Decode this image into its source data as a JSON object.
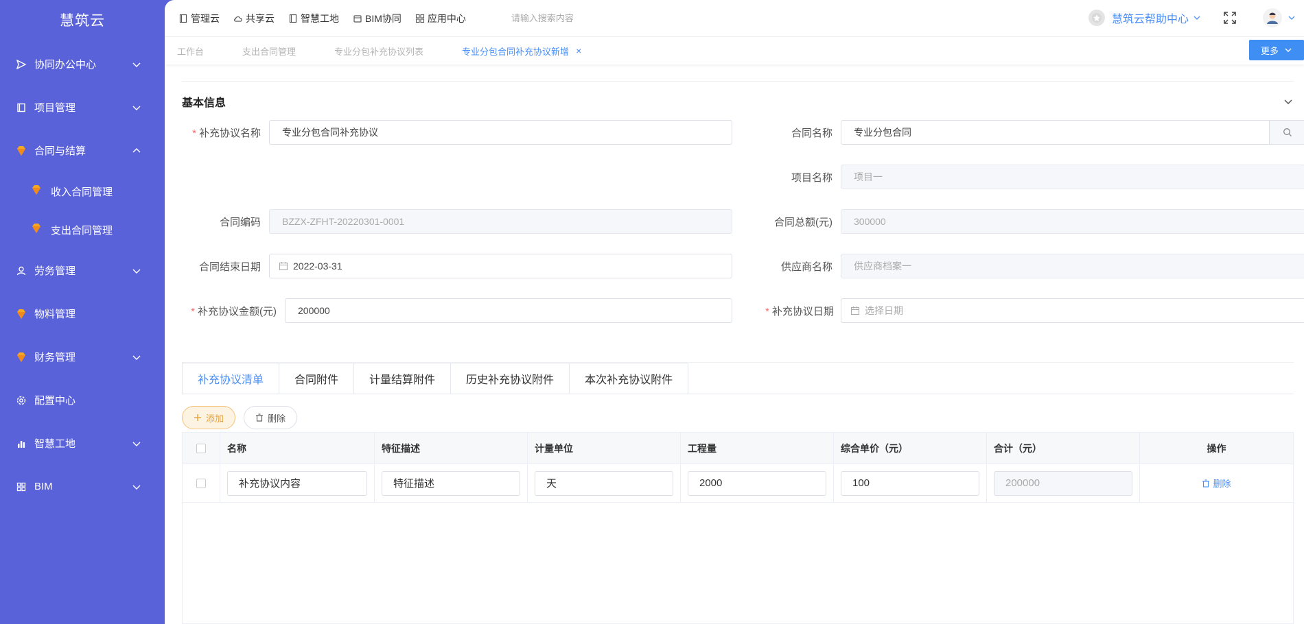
{
  "app": {
    "logo": "慧筑云"
  },
  "sidebar": {
    "items": [
      {
        "label": "协同办公中心",
        "icon": "send-icon",
        "expandable": true
      },
      {
        "label": "项目管理",
        "icon": "book-icon",
        "expandable": true
      },
      {
        "label": "合同与结算",
        "icon": "diamond-icon",
        "expandable": true,
        "expanded": true
      },
      {
        "label": "劳务管理",
        "icon": "user-icon",
        "expandable": true
      },
      {
        "label": "物料管理",
        "icon": "diamond-icon",
        "expandable": false
      },
      {
        "label": "财务管理",
        "icon": "diamond-icon",
        "expandable": true
      },
      {
        "label": "配置中心",
        "icon": "gear-icon",
        "expandable": false
      },
      {
        "label": "智慧工地",
        "icon": "bar-chart-icon",
        "expandable": true
      },
      {
        "label": "BIM",
        "icon": "grid-icon",
        "expandable": true
      }
    ],
    "submenu": [
      {
        "label": "收入合同管理"
      },
      {
        "label": "支出合同管理"
      }
    ]
  },
  "topnav": {
    "items": [
      {
        "label": "管理云"
      },
      {
        "label": "共享云"
      },
      {
        "label": "智慧工地"
      },
      {
        "label": "BIM协同"
      },
      {
        "label": "应用中心"
      }
    ],
    "search_placeholder": "请输入搜索内容",
    "help_label": "慧筑云帮助中心"
  },
  "page_tabs": {
    "items": [
      {
        "label": "工作台"
      },
      {
        "label": "支出合同管理"
      },
      {
        "label": "专业分包补充协议列表"
      },
      {
        "label": "专业分包合同补充协议新增"
      }
    ],
    "close_symbol": "×",
    "more_label": "更多"
  },
  "form": {
    "section_title": "基本信息",
    "supplement_name": {
      "label": "补充协议名称",
      "value": "专业分包合同补充协议"
    },
    "contract_name": {
      "label": "合同名称",
      "value": "专业分包合同"
    },
    "project_name": {
      "label": "项目名称",
      "placeholder": "项目一"
    },
    "contract_code": {
      "label": "合同编码",
      "placeholder": "BZZX-ZFHT-20220301-0001"
    },
    "contract_total": {
      "label": "合同总额(元)",
      "placeholder": "300000"
    },
    "contract_end_date": {
      "label": "合同结束日期",
      "value": "2022-03-31"
    },
    "supplier_name": {
      "label": "供应商名称",
      "placeholder": "供应商档案一"
    },
    "supplement_amount": {
      "label": "补充协议金额(元)",
      "value": "200000"
    },
    "supplement_date": {
      "label": "补充协议日期",
      "placeholder": "选择日期"
    },
    "required_mark": "*"
  },
  "detail_tabs": {
    "items": [
      {
        "label": "补充协议清单"
      },
      {
        "label": "合同附件"
      },
      {
        "label": "计量结算附件"
      },
      {
        "label": "历史补充协议附件"
      },
      {
        "label": "本次补充协议附件"
      }
    ]
  },
  "toolbar": {
    "add_label": "添加",
    "delete_label": "删除"
  },
  "table": {
    "columns": [
      "名称",
      "特征描述",
      "计量单位",
      "工程量",
      "综合单价（元）",
      "合计（元）",
      "操作"
    ],
    "rows": [
      {
        "name": "补充协议内容",
        "feature": "特征描述",
        "unit": "天",
        "qty": "2000",
        "price": "100",
        "total": "200000",
        "op": "删除"
      }
    ]
  },
  "colors": {
    "sidebar": "#5a62d9",
    "primary": "#4a8ff7",
    "warning": "#e6a23c",
    "danger": "#f56c6c"
  }
}
